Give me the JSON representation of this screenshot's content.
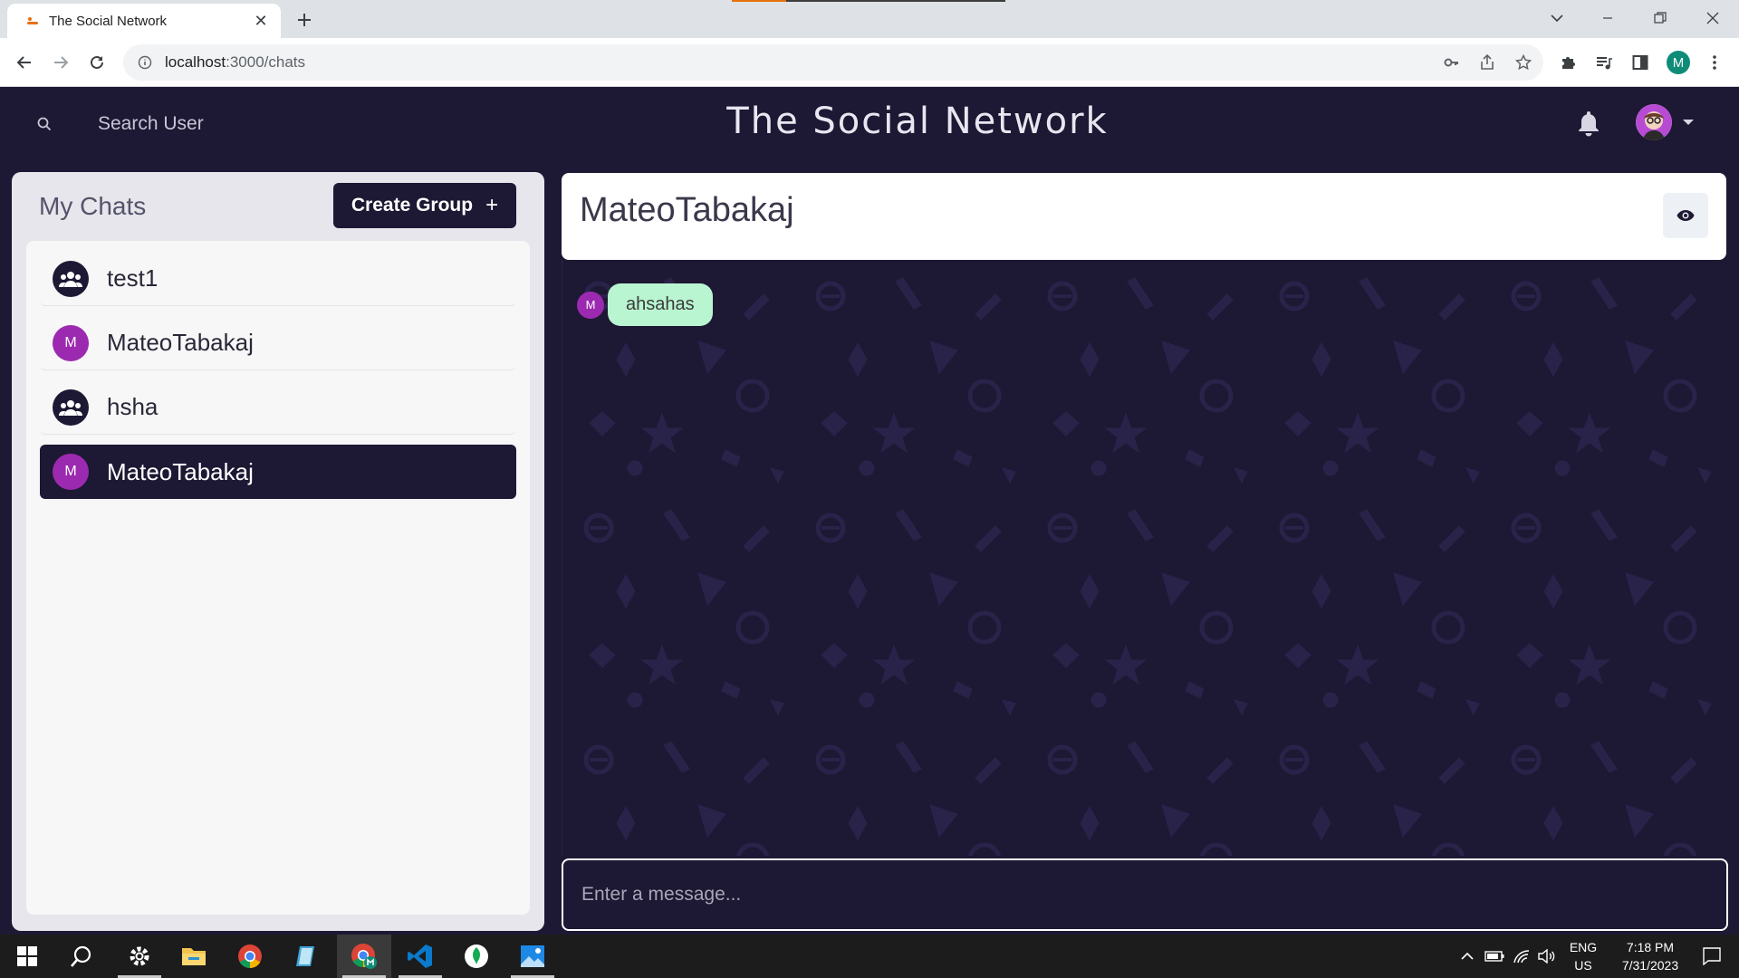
{
  "browser": {
    "tab_title": "The Social Network",
    "tab_close": "✕",
    "new_tab": "+",
    "url_host": "localhost",
    "url_rest": ":3000/chats",
    "profile_initial": "M"
  },
  "app": {
    "title": "The Social Network",
    "search_label": "Search User"
  },
  "chats_panel": {
    "title": "My Chats",
    "create_group_label": "Create Group",
    "create_group_plus": "+",
    "items": [
      {
        "name": "test1",
        "type": "group",
        "initial": ""
      },
      {
        "name": "MateoTabakaj",
        "type": "user",
        "initial": "M"
      },
      {
        "name": "hsha",
        "type": "group",
        "initial": ""
      },
      {
        "name": "MateoTabakaj",
        "type": "user",
        "initial": "M",
        "selected": true
      }
    ]
  },
  "chat": {
    "title": "MateoTabakaj",
    "messages": [
      {
        "sender_initial": "M",
        "text": "ahsahas"
      }
    ],
    "input_placeholder": "Enter a message..."
  },
  "taskbar": {
    "language": "ENG",
    "region": "US",
    "time": "7:18 PM",
    "date": "7/31/2023"
  },
  "colors": {
    "app_bg": "#1d1833",
    "accent_purple": "#9c2ab0",
    "message_bubble": "#b9f5d0"
  }
}
